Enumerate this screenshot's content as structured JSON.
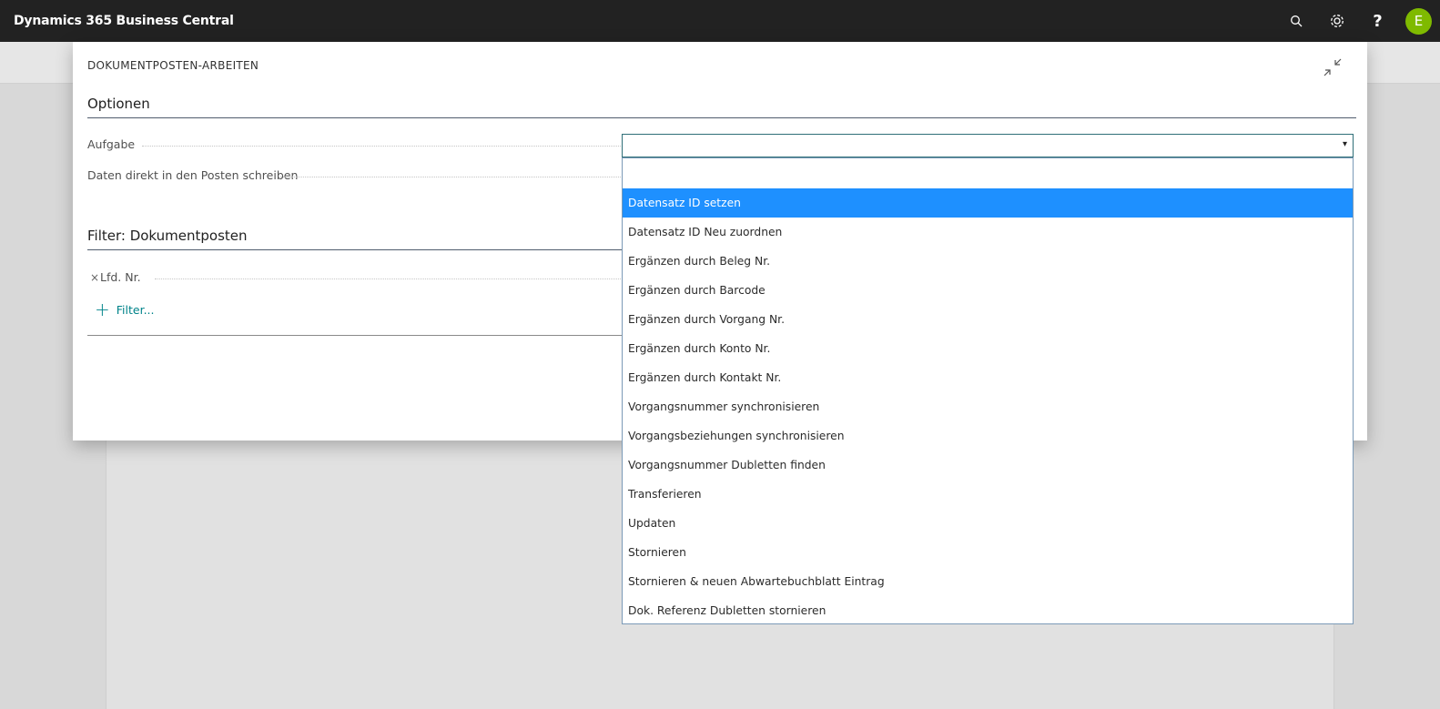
{
  "app": {
    "title": "Dynamics 365 Business Central",
    "user_initial": "E"
  },
  "appbar": {
    "icons": [
      "search-icon",
      "settings-icon",
      "help-icon"
    ],
    "help_label": "?"
  },
  "dialog": {
    "caption": "DOKUMENTPOSTEN-ARBEITEN",
    "options_title": "Optionen",
    "aufgabe_label": "Aufgabe",
    "daten_label": "Daten direkt in den Posten schreiben",
    "filter_title": "Filter: Dokumentposten",
    "filter_field_label": "Lfd. Nr.",
    "filter_remove": "×",
    "add_filter_label": "Filter...",
    "add_filter_plus": "+"
  },
  "combo": {
    "value": "",
    "arrow": "▾"
  },
  "dropdown": {
    "options": [
      "",
      "Datensatz ID setzen",
      "Datensatz ID Neu zuordnen",
      "Ergänzen durch Beleg Nr.",
      "Ergänzen durch Barcode",
      "Ergänzen durch Vorgang Nr.",
      "Ergänzen durch Konto Nr.",
      "Ergänzen durch Kontakt Nr.",
      "Vorgangsnummer synchronisieren",
      "Vorgangsbeziehungen synchronisieren",
      "Vorgangsnummer Dubletten finden",
      "Transferieren",
      "Updaten",
      "Stornieren",
      "Stornieren & neuen Abwartebuchblatt Eintrag",
      "Dok. Referenz Dubletten stornieren"
    ],
    "highlighted": "Datensatz ID setzen"
  },
  "colors": {
    "appbar": "#222222",
    "avatar": "#7fba00",
    "highlight": "#1e90ff",
    "accent": "#00838a"
  }
}
